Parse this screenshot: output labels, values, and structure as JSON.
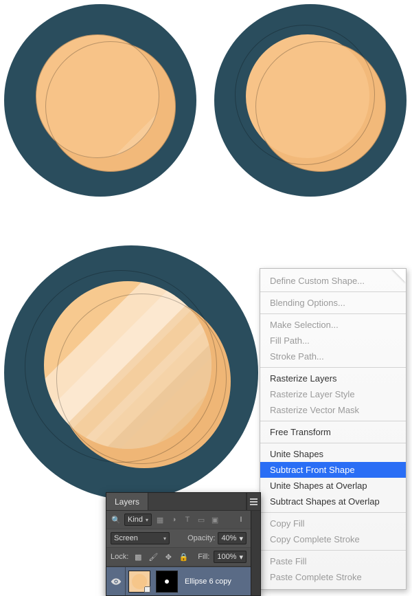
{
  "context_menu": {
    "items": [
      {
        "label": "Define Custom Shape...",
        "enabled": false
      },
      {
        "sep": true
      },
      {
        "label": "Blending Options...",
        "enabled": false
      },
      {
        "sep": true
      },
      {
        "label": "Make Selection...",
        "enabled": false
      },
      {
        "label": "Fill Path...",
        "enabled": false
      },
      {
        "label": "Stroke Path...",
        "enabled": false
      },
      {
        "sep": true
      },
      {
        "label": "Rasterize Layers",
        "enabled": true
      },
      {
        "label": "Rasterize Layer Style",
        "enabled": false
      },
      {
        "label": "Rasterize Vector Mask",
        "enabled": false
      },
      {
        "sep": true
      },
      {
        "label": "Free Transform",
        "enabled": true
      },
      {
        "sep": true
      },
      {
        "label": "Unite Shapes",
        "enabled": true
      },
      {
        "label": "Subtract Front Shape",
        "enabled": true,
        "selected": true
      },
      {
        "label": "Unite Shapes at Overlap",
        "enabled": true
      },
      {
        "label": "Subtract Shapes at Overlap",
        "enabled": true
      },
      {
        "sep": true
      },
      {
        "label": "Copy Fill",
        "enabled": false
      },
      {
        "label": "Copy Complete Stroke",
        "enabled": false
      },
      {
        "sep": true
      },
      {
        "label": "Paste Fill",
        "enabled": false
      },
      {
        "label": "Paste Complete Stroke",
        "enabled": false
      }
    ]
  },
  "layers_panel": {
    "title": "Layers",
    "filter_kind_label": "Kind",
    "blend_mode": "Screen",
    "opacity_label": "Opacity:",
    "opacity_value": "40%",
    "lock_label": "Lock:",
    "fill_label": "Fill:",
    "fill_value": "100%",
    "layer_name": "Ellipse 6 copy"
  }
}
